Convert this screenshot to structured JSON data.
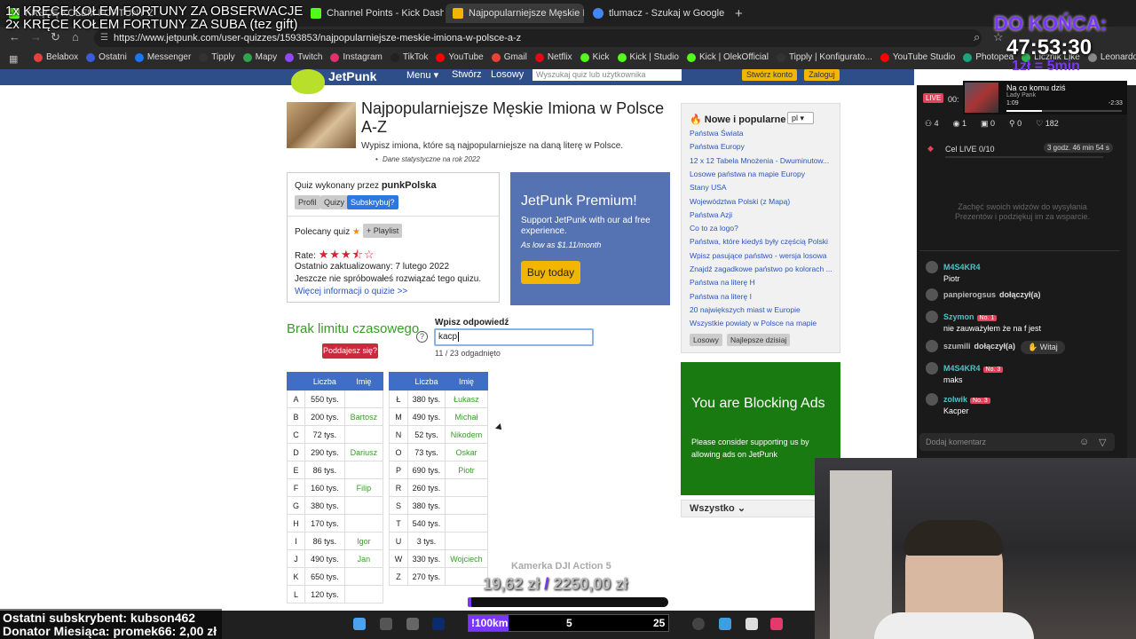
{
  "browser": {
    "tabs": [
      {
        "label": "KRĘCĘ KOŁEM FORTUNY ZA OBSERWACJE",
        "color": "#53fc18"
      },
      {
        "label": "Channel Points - Kick Dashboard",
        "color": "#53fc18"
      },
      {
        "label": "Najpopularniejsze Męskie Imiona",
        "color": "#f2b600"
      },
      {
        "label": "tlumacz - Szukaj w Google",
        "color": "#4285f4"
      }
    ],
    "url": "https://www.jetpunk.com/user-quizzes/1593853/najpopularniejsze-meskie-imiona-w-polsce-a-z",
    "bookmarks": [
      "Belabox",
      "Ostatni",
      "Messenger",
      "Tipply",
      "Mapy",
      "Twitch",
      "Instagram",
      "TikTok",
      "YouTube",
      "Gmail",
      "Netflix",
      "Kick",
      "Kick | Studio",
      "Kick | OlekOfficial",
      "Tipply | Konfigurato...",
      "YouTube Studio",
      "Photopea",
      "Licznik Like",
      "Leonardo",
      "Freepik"
    ]
  },
  "overlay": {
    "line1": "1x KRĘCE KOŁEM FORTUNY ZA OBSERWACJE",
    "line2": "2x KRĘCE KOŁEM FORTUNY ZA SUBA (tez gift)",
    "countdown_label": "DO KOŃCA:",
    "countdown": "47:53:30",
    "countdown_sub": "1zł = 5min",
    "last_sub": "Ostatni subskrybent: kubson462",
    "donor": "Donator Miesiąca: promek66: 2,00 zł",
    "goal_title": "Kamerka DJI Action 5",
    "goal_amount": "19,62 zł",
    "goal_sep": "/",
    "goal_target": "2250,00 zł",
    "ticker_label": "!100km",
    "ticker_val1": "5",
    "ticker_val2": "25"
  },
  "jetpunk": {
    "logo": "JetPunk",
    "nav": [
      "Menu ▾",
      "Stwórz",
      "Losowy"
    ],
    "search_placeholder": "Wyszukaj quiz lub użytkownika",
    "btn_create": "Stwórz konto",
    "btn_login": "Zaloguj",
    "title": "Najpopularniejsze Męskie Imiona w Polsce A-Z",
    "subtitle": "Wypisz imiona, które są najpopularniejsze na daną literę w Polsce.",
    "note": "Dane statystyczne na rok 2022",
    "made_by_prefix": "Quiz wykonany przez ",
    "made_by_user": "punkPolska",
    "btn_profile": "Profil",
    "btn_quizzes": "Quizy",
    "btn_subscribe": "Subskrybuj?",
    "recommended": "Polecany quiz",
    "playlist": "+ Playlist",
    "rate_label": "Rate:",
    "rating": 3.5,
    "updated": "Ostatnio zaktualizowany: 7 lutego 2022",
    "not_tried": "Jeszcze nie spróbowałeś rozwiązać tego quizu.",
    "more_info": "Więcej informacji o quizie >>",
    "premium_title": "JetPunk Premium!",
    "premium_sub": "Support JetPunk with our ad free experience.",
    "premium_price": "As low as $1.11/month",
    "buy": "Buy today",
    "no_limit": "Brak limitu czasowego",
    "give_up": "Poddajesz się?",
    "answer_label": "Wpisz odpowiedź",
    "answer_value": "kacp",
    "guessed": "11 / 23 odgadnięto",
    "col_count": "Liczba",
    "col_name": "Imię"
  },
  "table_left": [
    [
      "A",
      "550 tys.",
      ""
    ],
    [
      "B",
      "200 tys.",
      "Bartosz"
    ],
    [
      "C",
      "72 tys.",
      ""
    ],
    [
      "D",
      "290 tys.",
      "Dariusz"
    ],
    [
      "E",
      "86 tys.",
      ""
    ],
    [
      "F",
      "160 tys.",
      "Filip"
    ],
    [
      "G",
      "380 tys.",
      ""
    ],
    [
      "H",
      "170 tys.",
      ""
    ],
    [
      "I",
      "86 tys.",
      "Igor"
    ],
    [
      "J",
      "490 tys.",
      "Jan"
    ],
    [
      "K",
      "650 tys.",
      ""
    ],
    [
      "L",
      "120 tys.",
      ""
    ]
  ],
  "table_right": [
    [
      "Ł",
      "380 tys.",
      "Łukasz"
    ],
    [
      "M",
      "490 tys.",
      "Michał"
    ],
    [
      "N",
      "52 tys.",
      "Nikodem"
    ],
    [
      "O",
      "73 tys.",
      "Oskar"
    ],
    [
      "P",
      "690 tys.",
      "Piotr"
    ],
    [
      "R",
      "260 tys.",
      ""
    ],
    [
      "S",
      "380 tys.",
      ""
    ],
    [
      "T",
      "540 tys.",
      ""
    ],
    [
      "U",
      "3 tys.",
      ""
    ],
    [
      "W",
      "330 tys.",
      "Wojciech"
    ],
    [
      "Z",
      "270 tys.",
      ""
    ]
  ],
  "sidebar": {
    "title": "Nowe i popularne",
    "lang": "pl",
    "links": [
      "Państwa Świata",
      "Państwa Europy",
      "12 x 12 Tabela Mnożenia - Dwuminutow...",
      "Losowe państwa na mapie Europy",
      "Stany USA",
      "Województwa Polski (z Mapą)",
      "Państwa Azji",
      "Co to za logo?",
      "Państwa, które kiedyś były częścią Polski",
      "Wpisz pasujące państwo - wersja losowa",
      "Znajdź zagadkowe państwo po kolorach ...",
      "Państwa na literę H",
      "Państwa na literę I",
      "20 największych miast w Europie",
      "Wszystkie powiaty w Polsce na mapie"
    ],
    "btn_random": "Losowy",
    "btn_best": "Najlepsze dzisiaj",
    "ad_title": "You are Blocking Ads",
    "ad_sub": "Please consider supporting us by allowing ads on JetPunk",
    "all": "Wszystko"
  },
  "kick": {
    "live": "LIVE",
    "viewers_time": "00:",
    "now_playing_label": "Na co komu dziś",
    "artist": "Lady Pank",
    "time_cur": "1:09",
    "time_left": "-2:33",
    "stats": [
      "4",
      "1",
      "0",
      "0",
      "182"
    ],
    "goal_label": "Cel LIVE",
    "goal_value": "0/10",
    "goal_time": "3 godz. 46 min 54 s",
    "empty_text": "Zachęć swoich widzów do wysyłania Prezentów i podziękuj im za wsparcie.",
    "chat": [
      {
        "user": "M4S4KR4",
        "badge": "",
        "msg": "Piotr",
        "userColor": "#4fc3c7"
      },
      {
        "user": "panpierogsus",
        "badge": "",
        "msg": "dołączył(a)",
        "userColor": "#bbbbbb"
      },
      {
        "user": "Szymon",
        "badge": "No. 1",
        "msg": "nie zauważyłem że na f jest",
        "userColor": "#4fc3c7"
      },
      {
        "user": "szumili",
        "badge": "",
        "msg": "dołączył(a)",
        "userColor": "#bbbbbb"
      },
      {
        "user": "M4S4KR4",
        "badge": "No. 3",
        "msg": "maks",
        "userColor": "#4fc3c7"
      },
      {
        "user": "zolwik",
        "badge": "No. 3",
        "msg": "Kacper",
        "userColor": "#4fc3c7"
      }
    ],
    "witaj": "Witaj",
    "comment_placeholder": "Dodaj komentarz"
  }
}
